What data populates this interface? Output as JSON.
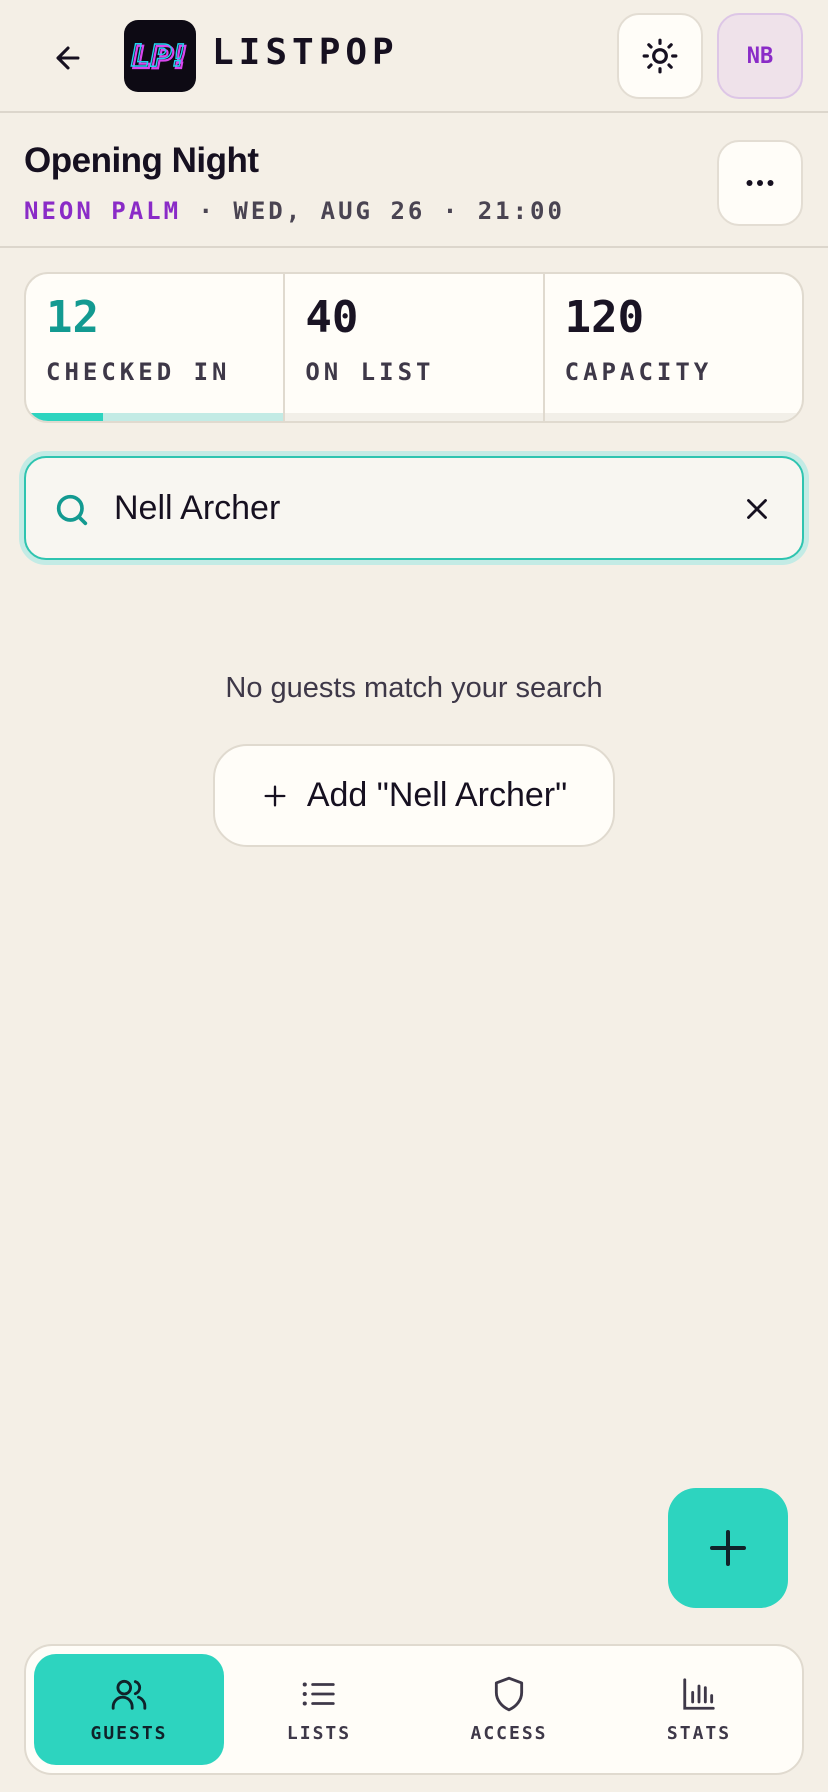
{
  "app": {
    "brand": "LISTPOP",
    "logo_text": "LP!",
    "avatar_initials": "NB"
  },
  "event": {
    "title": "Opening Night",
    "venue": "NEON PALM",
    "details": "· WED, AUG 26 · 21:00"
  },
  "stats": {
    "checked_in": {
      "value": "12",
      "label": "CHECKED IN",
      "progress_fraction": 0.3
    },
    "on_list": {
      "value": "40",
      "label": "ON LIST"
    },
    "capacity": {
      "value": "120",
      "label": "CAPACITY"
    }
  },
  "search": {
    "value": "Nell Archer",
    "placeholder": ""
  },
  "empty_state": {
    "message": "No guests match your search",
    "add_label": "Add \"Nell Archer\""
  },
  "nav": {
    "items": [
      {
        "label": "GUESTS",
        "icon": "users-icon",
        "active": true
      },
      {
        "label": "LISTS",
        "icon": "list-icon",
        "active": false
      },
      {
        "label": "ACCESS",
        "icon": "shield-icon",
        "active": false
      },
      {
        "label": "STATS",
        "icon": "bar-chart-icon",
        "active": false
      }
    ]
  },
  "colors": {
    "accent": "#2dd4bf",
    "accent_dark": "#139a91",
    "venue_purple": "#8a2bc7",
    "background": "#f4efe6"
  }
}
